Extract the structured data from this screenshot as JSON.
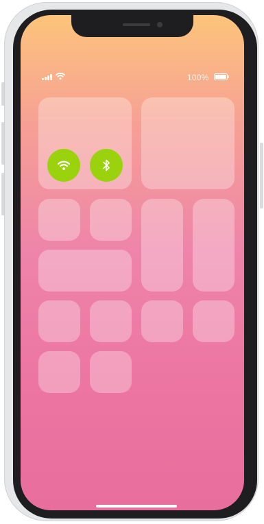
{
  "status_bar": {
    "signal_icon": "cellular-signal-icon",
    "wifi_icon": "wifi-icon",
    "battery_percent": "100%",
    "battery_level": 1.0,
    "battery_icon": "battery-full-icon"
  },
  "connectivity": {
    "wifi_toggle": {
      "icon": "wifi-icon",
      "state": "on",
      "color": "#9bd20e"
    },
    "bluetooth_toggle": {
      "icon": "bluetooth-icon",
      "state": "on",
      "color": "#9bd20e"
    }
  },
  "colors": {
    "gradient_top": "#fdc47b",
    "gradient_bottom": "#e86e9d",
    "toggle_active": "#9bd20e",
    "tile_fill": "rgba(255,255,255,0.30)"
  }
}
